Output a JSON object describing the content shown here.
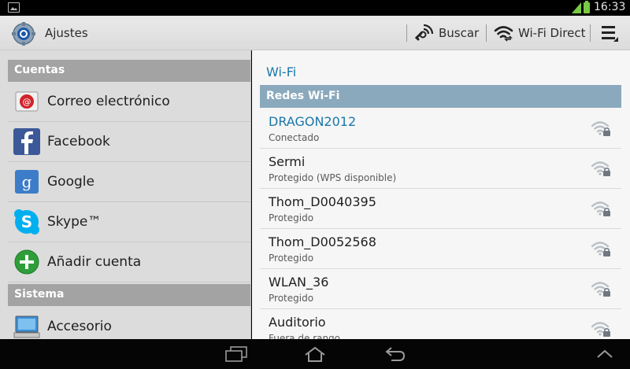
{
  "status_bar": {
    "time": "16:33",
    "battery_color": "#7ac943",
    "icons": [
      "image-notification-icon",
      "signal-icon",
      "battery-icon"
    ]
  },
  "action_bar": {
    "title": "Ajustes",
    "search_label": "Buscar",
    "wifi_direct_label": "Wi-Fi Direct",
    "icons": [
      "settings-gear-icon",
      "search-icon",
      "wifi-direct-icon",
      "overflow-menu-icon"
    ]
  },
  "left_pane": {
    "sections": [
      {
        "title": "Cuentas"
      },
      {
        "title": "Sistema"
      }
    ],
    "items": [
      {
        "label": "Correo electrónico",
        "icon": "email-icon"
      },
      {
        "label": "Facebook",
        "icon": "facebook-icon"
      },
      {
        "label": "Google",
        "icon": "google-icon"
      },
      {
        "label": "Skype™",
        "icon": "skype-icon"
      },
      {
        "label": "Añadir cuenta",
        "icon": "add-account-icon"
      },
      {
        "label": "Accesorio",
        "icon": "accessory-icon"
      }
    ]
  },
  "right_pane": {
    "title": "Wi-Fi",
    "networks_header": "Redes Wi-Fi",
    "networks": [
      {
        "name": "DRAGON2012",
        "status": "Conectado",
        "connected": true,
        "icon": "wifi-locked-icon"
      },
      {
        "name": "Sermi",
        "status": "Protegido (WPS disponible)",
        "connected": false,
        "icon": "wifi-locked-icon"
      },
      {
        "name": "Thom_D0040395",
        "status": "Protegido",
        "connected": false,
        "icon": "wifi-locked-icon"
      },
      {
        "name": "Thom_D0052568",
        "status": "Protegido",
        "connected": false,
        "icon": "wifi-locked-icon"
      },
      {
        "name": "WLAN_36",
        "status": "Protegido",
        "connected": false,
        "icon": "wifi-locked-icon"
      },
      {
        "name": "Auditorio",
        "status": "Fuera de rango",
        "connected": false,
        "icon": "wifi-locked-icon"
      }
    ]
  },
  "nav_bar": {
    "icons": [
      "recent-apps-icon",
      "home-icon",
      "back-icon",
      "expand-up-icon"
    ]
  },
  "colors": {
    "accent": "#1a77a8",
    "section_header": "#a3a3a3",
    "networks_header": "#8ba9bd"
  }
}
